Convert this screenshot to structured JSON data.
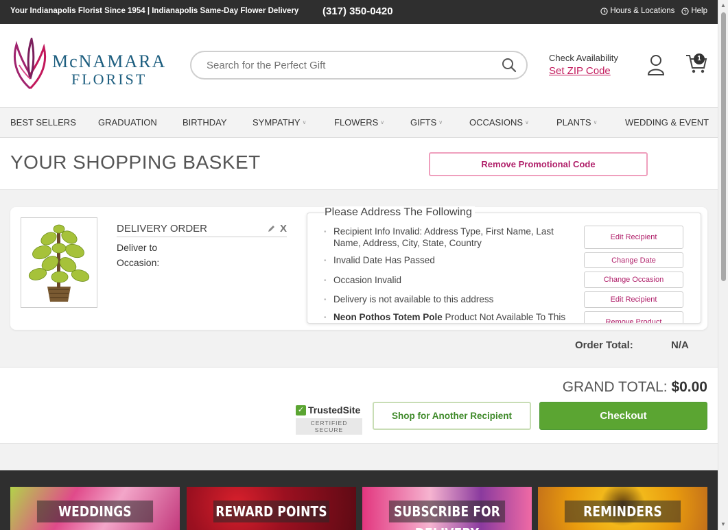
{
  "topbar": {
    "tagline": "Your Indianapolis Florist Since 1954 | Indianapolis Same-Day Flower Delivery",
    "phone": "(317) 350-0420",
    "hours_label": "Hours & Locations",
    "help_label": "Help"
  },
  "header": {
    "logo_line1": "McNAMARA",
    "logo_line2": "FLORIST",
    "search_placeholder": "Search for the Perfect Gift",
    "zip_label": "Check Availability",
    "zip_link": "Set ZIP Code",
    "cart_count": "1"
  },
  "nav": {
    "items": [
      {
        "label": "BEST SELLERS",
        "dropdown": false
      },
      {
        "label": "GRADUATION",
        "dropdown": false
      },
      {
        "label": "BIRTHDAY",
        "dropdown": false
      },
      {
        "label": "SYMPATHY",
        "dropdown": true
      },
      {
        "label": "FLOWERS",
        "dropdown": true
      },
      {
        "label": "GIFTS",
        "dropdown": true
      },
      {
        "label": "OCCASIONS",
        "dropdown": true
      },
      {
        "label": "PLANTS",
        "dropdown": true
      },
      {
        "label": "WEDDING & EVENT",
        "dropdown": false
      }
    ]
  },
  "basket": {
    "title": "YOUR SHOPPING BASKET",
    "promo_button": "Remove Promotional Code",
    "order_heading": "DELIVERY ORDER",
    "deliver_to_label": "Deliver to",
    "occasion_label": "Occasion:",
    "issues_title": "Please Address The Following",
    "issues": [
      {
        "text": "Recipient Info Invalid: Address Type, First Name, Last Name, Address, City, State, Country",
        "button": "Edit Recipient"
      },
      {
        "text": "Invalid Date Has Passed",
        "button": "Change Date"
      },
      {
        "text": "Occasion Invalid",
        "button": "Change Occasion"
      },
      {
        "text": "Delivery is not available to this address",
        "button": "Edit Recipient"
      },
      {
        "bold": "Neon Pothos Totem Pole",
        "text": " Product Not Available To This Location",
        "button": "Remove Product"
      }
    ],
    "order_total_label": "Order Total:",
    "order_total_value": "N/A"
  },
  "totals": {
    "grand_label": "GRAND TOTAL:",
    "grand_value": "$0.00",
    "trusted_name": "TrustedSite",
    "trusted_sub": "CERTIFIED SECURE",
    "shop_button": "Shop for Another Recipient",
    "checkout_button": "Checkout"
  },
  "footer": {
    "tiles": [
      "WEDDINGS",
      "REWARD POINTS",
      "SUBSCRIBE FOR DELIVERY",
      "REMINDERS"
    ]
  },
  "colors": {
    "brand_pink": "#b0206a",
    "brand_blue": "#1d5e7f",
    "checkout_green": "#5ba532",
    "topbar_bg": "#2f2f2f"
  }
}
